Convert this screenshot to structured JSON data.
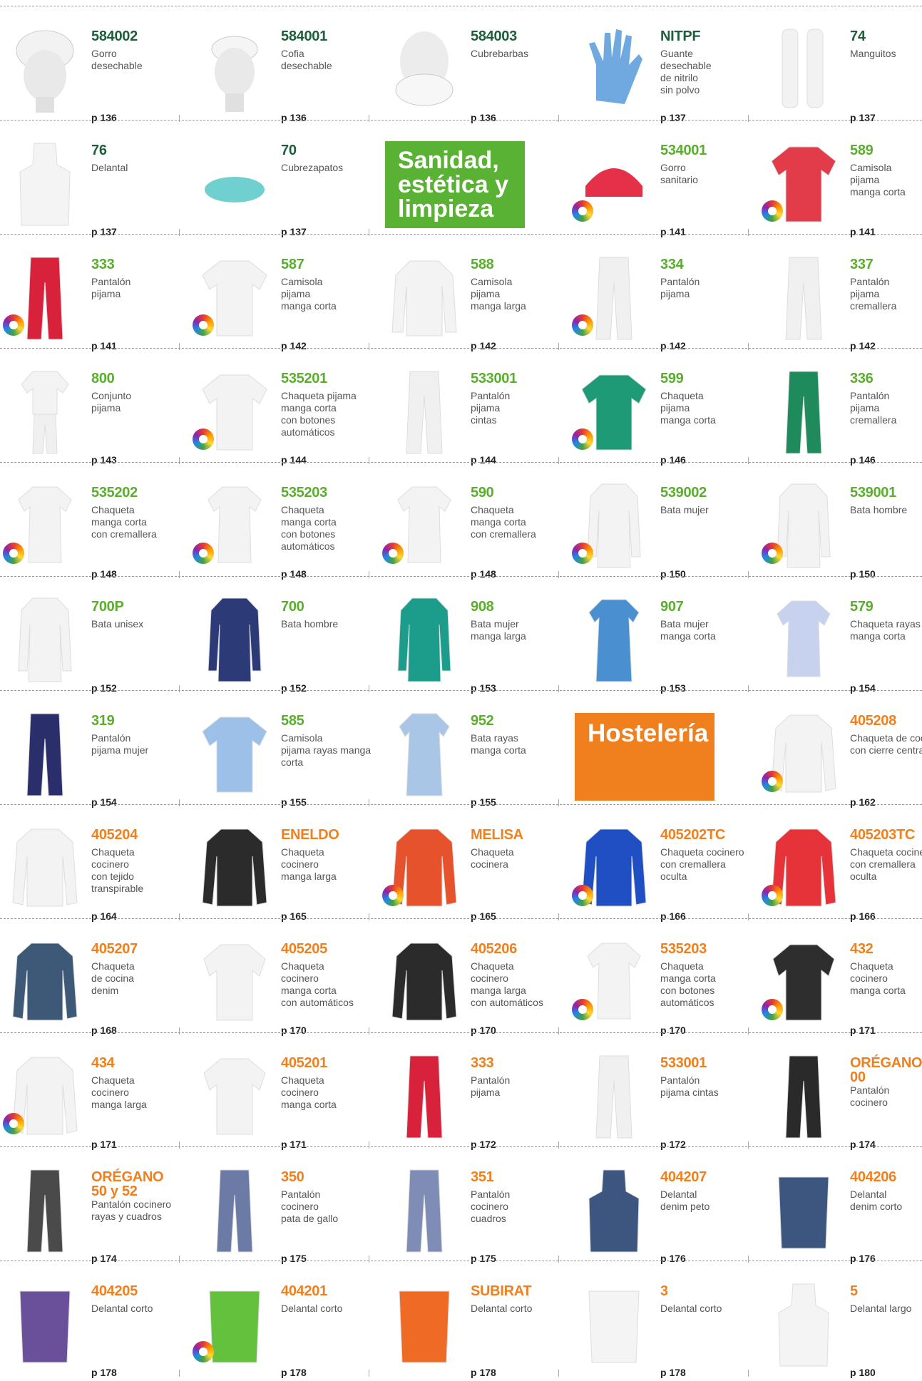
{
  "banners": {
    "sanidad": "Sanidad, estética y limpieza",
    "hosteleria": "Hostelería"
  },
  "colors": {
    "dark_green": "#1f5e3b",
    "green": "#5aae2e",
    "orange": "#f07f1d",
    "banner_green": "#59b233",
    "banner_orange": "#f07f1d"
  },
  "rows": [
    [
      {
        "code": "584002",
        "desc": "Gorro\ndesechable",
        "page": "p 136",
        "theme": "green",
        "icon": "head-bouffant-cap",
        "wheel": false
      },
      {
        "code": "584001",
        "desc": "Cofia\ndesechable",
        "page": "p 136",
        "theme": "green",
        "icon": "head-cap",
        "wheel": false
      },
      {
        "code": "584003",
        "desc": "Cubrebarbas",
        "page": "p 136",
        "theme": "green",
        "icon": "head-beard-cover",
        "wheel": false
      },
      {
        "code": "NITPF",
        "desc": "Guante\ndesechable\nde nitrilo\nsin polvo",
        "page": "p 137",
        "theme": "green",
        "icon": "glove",
        "wheel": false
      },
      {
        "code": "74",
        "desc": "Manguitos",
        "page": "p 137",
        "theme": "green",
        "icon": "sleeves",
        "wheel": false
      }
    ],
    [
      {
        "code": "76",
        "desc": "Delantal",
        "page": "p 137",
        "theme": "green",
        "icon": "apron",
        "wheel": false
      },
      {
        "code": "70",
        "desc": "Cubrezapatos",
        "page": "p 137",
        "theme": "green",
        "icon": "shoe-cover",
        "wheel": false
      },
      null,
      {
        "code": "534001",
        "desc": "Gorro\nsanitario",
        "page": "p 141",
        "theme": "lime",
        "icon": "scrub-cap",
        "wheel": true
      },
      {
        "code": "589",
        "desc": "Camisola\npijama\nmanga corta",
        "page": "p 141",
        "theme": "lime",
        "icon": "shirt-short",
        "wheel": true
      }
    ],
    [
      {
        "code": "333",
        "desc": "Pantalón\npijama",
        "page": "p 141",
        "theme": "lime",
        "icon": "trousers",
        "wheel": true
      },
      {
        "code": "587",
        "desc": "Camisola\npijama\nmanga corta",
        "page": "p 142",
        "theme": "lime",
        "icon": "shirt-short",
        "wheel": true
      },
      {
        "code": "588",
        "desc": "Camisola\npijama\nmanga larga",
        "page": "p 142",
        "theme": "lime",
        "icon": "shirt-long",
        "wheel": false
      },
      {
        "code": "334",
        "desc": "Pantalón\npijama",
        "page": "p 142",
        "theme": "lime",
        "icon": "trousers",
        "wheel": true
      },
      {
        "code": "337",
        "desc": "Pantalón\npijama\ncremallera",
        "page": "p 142",
        "theme": "lime",
        "icon": "trousers",
        "wheel": false
      }
    ],
    [
      {
        "code": "800",
        "desc": "Conjunto\npijama",
        "page": "p 143",
        "theme": "lime",
        "icon": "full-suit",
        "wheel": false
      },
      {
        "code": "535201",
        "desc": "Chaqueta pijama\nmanga corta\ncon botones\nautomáticos",
        "page": "p 144",
        "theme": "lime",
        "icon": "shirt-short",
        "wheel": true
      },
      {
        "code": "533001",
        "desc": "Pantalón\npijama\ncintas",
        "page": "p 144",
        "theme": "lime",
        "icon": "trousers",
        "wheel": false
      },
      {
        "code": "599",
        "desc": "Chaqueta\npijama\nmanga corta",
        "page": "p 146",
        "theme": "lime",
        "icon": "shirt-short",
        "wheel": true
      },
      {
        "code": "336",
        "desc": "Pantalón\npijama\ncremallera",
        "page": "p 146",
        "theme": "lime",
        "icon": "trousers",
        "wheel": false
      }
    ],
    [
      {
        "code": "535202",
        "desc": "Chaqueta\nmanga corta\ncon cremallera",
        "page": "p 148",
        "theme": "lime",
        "icon": "tunic-short",
        "wheel": true
      },
      {
        "code": "535203",
        "desc": "Chaqueta\nmanga corta\ncon botones\nautomáticos",
        "page": "p 148",
        "theme": "lime",
        "icon": "tunic-short",
        "wheel": true
      },
      {
        "code": "590",
        "desc": "Chaqueta\nmanga corta\ncon cremallera",
        "page": "p 148",
        "theme": "lime",
        "icon": "tunic-short",
        "wheel": true
      },
      {
        "code": "539002",
        "desc": "Bata mujer",
        "page": "p 150",
        "theme": "lime",
        "icon": "lab-coat",
        "wheel": true
      },
      {
        "code": "539001",
        "desc": "Bata hombre",
        "page": "p 150",
        "theme": "lime",
        "icon": "lab-coat",
        "wheel": true
      }
    ],
    [
      {
        "code": "700P",
        "desc": "Bata unisex",
        "page": "p 152",
        "theme": "lime",
        "icon": "lab-coat",
        "wheel": false
      },
      {
        "code": "700",
        "desc": "Bata hombre",
        "page": "p 152",
        "theme": "lime",
        "icon": "lab-coat",
        "wheel": false
      },
      {
        "code": "908",
        "desc": "Bata mujer\nmanga larga",
        "page": "p 153",
        "theme": "lime",
        "icon": "lab-coat",
        "wheel": false
      },
      {
        "code": "907",
        "desc": "Bata mujer\nmanga corta",
        "page": "p 153",
        "theme": "lime",
        "icon": "dress-coat",
        "wheel": false
      },
      {
        "code": "579",
        "desc": "Chaqueta rayas\nmanga corta",
        "page": "p 154",
        "theme": "lime",
        "icon": "tunic-short",
        "wheel": false
      }
    ],
    [
      {
        "code": "319",
        "desc": "Pantalón\npijama mujer",
        "page": "p 154",
        "theme": "lime",
        "icon": "trousers",
        "wheel": false
      },
      {
        "code": "585",
        "desc": "Camisola\npijama rayas manga\ncorta",
        "page": "p 155",
        "theme": "lime",
        "icon": "shirt-short",
        "wheel": false
      },
      {
        "code": "952",
        "desc": "Bata rayas\nmanga corta",
        "page": "p 155",
        "theme": "lime",
        "icon": "dress-coat",
        "wheel": false
      },
      null,
      {
        "code": "405208",
        "desc": "Chaqueta de coci\ncon cierre centra",
        "page": "p 162",
        "theme": "orange",
        "icon": "chef-jacket",
        "wheel": true
      }
    ],
    [
      {
        "code": "405204",
        "desc": "Chaqueta\ncocinero\ncon tejido\ntranspirable",
        "page": "p 164",
        "theme": "orange",
        "icon": "chef-jacket",
        "wheel": false
      },
      {
        "code": "ENELDO",
        "desc": "Chaqueta\ncocinero\nmanga larga",
        "page": "p 165",
        "theme": "orange",
        "icon": "chef-jacket",
        "wheel": false
      },
      {
        "code": "MELISA",
        "desc": "Chaqueta\ncocinera",
        "page": "p 165",
        "theme": "orange",
        "icon": "chef-jacket",
        "wheel": true
      },
      {
        "code": "405202TC",
        "desc": "Chaqueta cocinero\ncon cremallera\noculta",
        "page": "p 166",
        "theme": "orange",
        "icon": "chef-jacket",
        "wheel": true
      },
      {
        "code": "405203TC",
        "desc": "Chaqueta cociner\ncon cremallera\noculta",
        "page": "p 166",
        "theme": "orange",
        "icon": "chef-jacket",
        "wheel": true
      }
    ],
    [
      {
        "code": "405207",
        "desc": "Chaqueta\nde cocina\ndenim",
        "page": "p 168",
        "theme": "orange",
        "icon": "chef-jacket",
        "wheel": false
      },
      {
        "code": "405205",
        "desc": "Chaqueta\ncocinero\nmanga corta\ncon automáticos",
        "page": "p 170",
        "theme": "orange",
        "icon": "chef-jacket-short",
        "wheel": false
      },
      {
        "code": "405206",
        "desc": "Chaqueta\ncocinero\nmanga larga\ncon automáticos",
        "page": "p 170",
        "theme": "orange",
        "icon": "chef-jacket",
        "wheel": false
      },
      {
        "code": "535203",
        "desc": "Chaqueta\nmanga corta\ncon botones\nautomáticos",
        "page": "p 170",
        "theme": "orange",
        "icon": "tunic-short",
        "wheel": true
      },
      {
        "code": "432",
        "desc": "Chaqueta\ncocinero\nmanga corta",
        "page": "p 171",
        "theme": "orange",
        "icon": "chef-jacket-short",
        "wheel": true
      }
    ],
    [
      {
        "code": "434",
        "desc": "Chaqueta\ncocinero\nmanga larga",
        "page": "p 171",
        "theme": "orange",
        "icon": "chef-jacket",
        "wheel": true
      },
      {
        "code": "405201",
        "desc": "Chaqueta\ncocinero\nmanga corta",
        "page": "p 171",
        "theme": "orange",
        "icon": "chef-jacket-short",
        "wheel": false
      },
      {
        "code": "333",
        "desc": "Pantalón\npijama",
        "page": "p 172",
        "theme": "orange",
        "icon": "trousers",
        "wheel": false
      },
      {
        "code": "533001",
        "desc": "Pantalón\npijama cintas",
        "page": "p 172",
        "theme": "orange",
        "icon": "trousers",
        "wheel": false
      },
      {
        "code": "ORÉGANO\n00",
        "desc": "Pantalón\ncocinero",
        "page": "p 174",
        "theme": "orange",
        "icon": "trousers",
        "wheel": false
      }
    ],
    [
      {
        "code": "ORÉGANO\n50 y 52",
        "desc": "Pantalón cocinero\nrayas y cuadros",
        "page": "p 174",
        "theme": "orange",
        "icon": "trousers",
        "wheel": false
      },
      {
        "code": "350",
        "desc": "Pantalón\ncocinero\npata de gallo",
        "page": "p 175",
        "theme": "orange",
        "icon": "trousers",
        "wheel": false
      },
      {
        "code": "351",
        "desc": "Pantalón\ncocinero\ncuadros",
        "page": "p 175",
        "theme": "orange",
        "icon": "trousers",
        "wheel": false
      },
      {
        "code": "404207",
        "desc": "Delantal\ndenim peto",
        "page": "p 176",
        "theme": "orange",
        "icon": "apron",
        "wheel": false
      },
      {
        "code": "404206",
        "desc": "Delantal\ndenim corto",
        "page": "p 176",
        "theme": "orange",
        "icon": "waist-apron",
        "wheel": false
      }
    ],
    [
      {
        "code": "404205",
        "desc": "Delantal corto",
        "page": "p 178",
        "theme": "orange",
        "icon": "waist-apron",
        "wheel": false
      },
      {
        "code": "404201",
        "desc": "Delantal corto",
        "page": "p 178",
        "theme": "orange",
        "icon": "waist-apron",
        "wheel": true
      },
      {
        "code": "SUBIRAT",
        "desc": "Delantal corto",
        "page": "p 178",
        "theme": "orange",
        "icon": "waist-apron",
        "wheel": false
      },
      {
        "code": "3",
        "desc": "Delantal corto",
        "page": "p 178",
        "theme": "orange",
        "icon": "waist-apron",
        "wheel": false
      },
      {
        "code": "5",
        "desc": "Delantal largo",
        "page": "p 180",
        "theme": "orange",
        "icon": "apron",
        "wheel": false
      }
    ]
  ]
}
